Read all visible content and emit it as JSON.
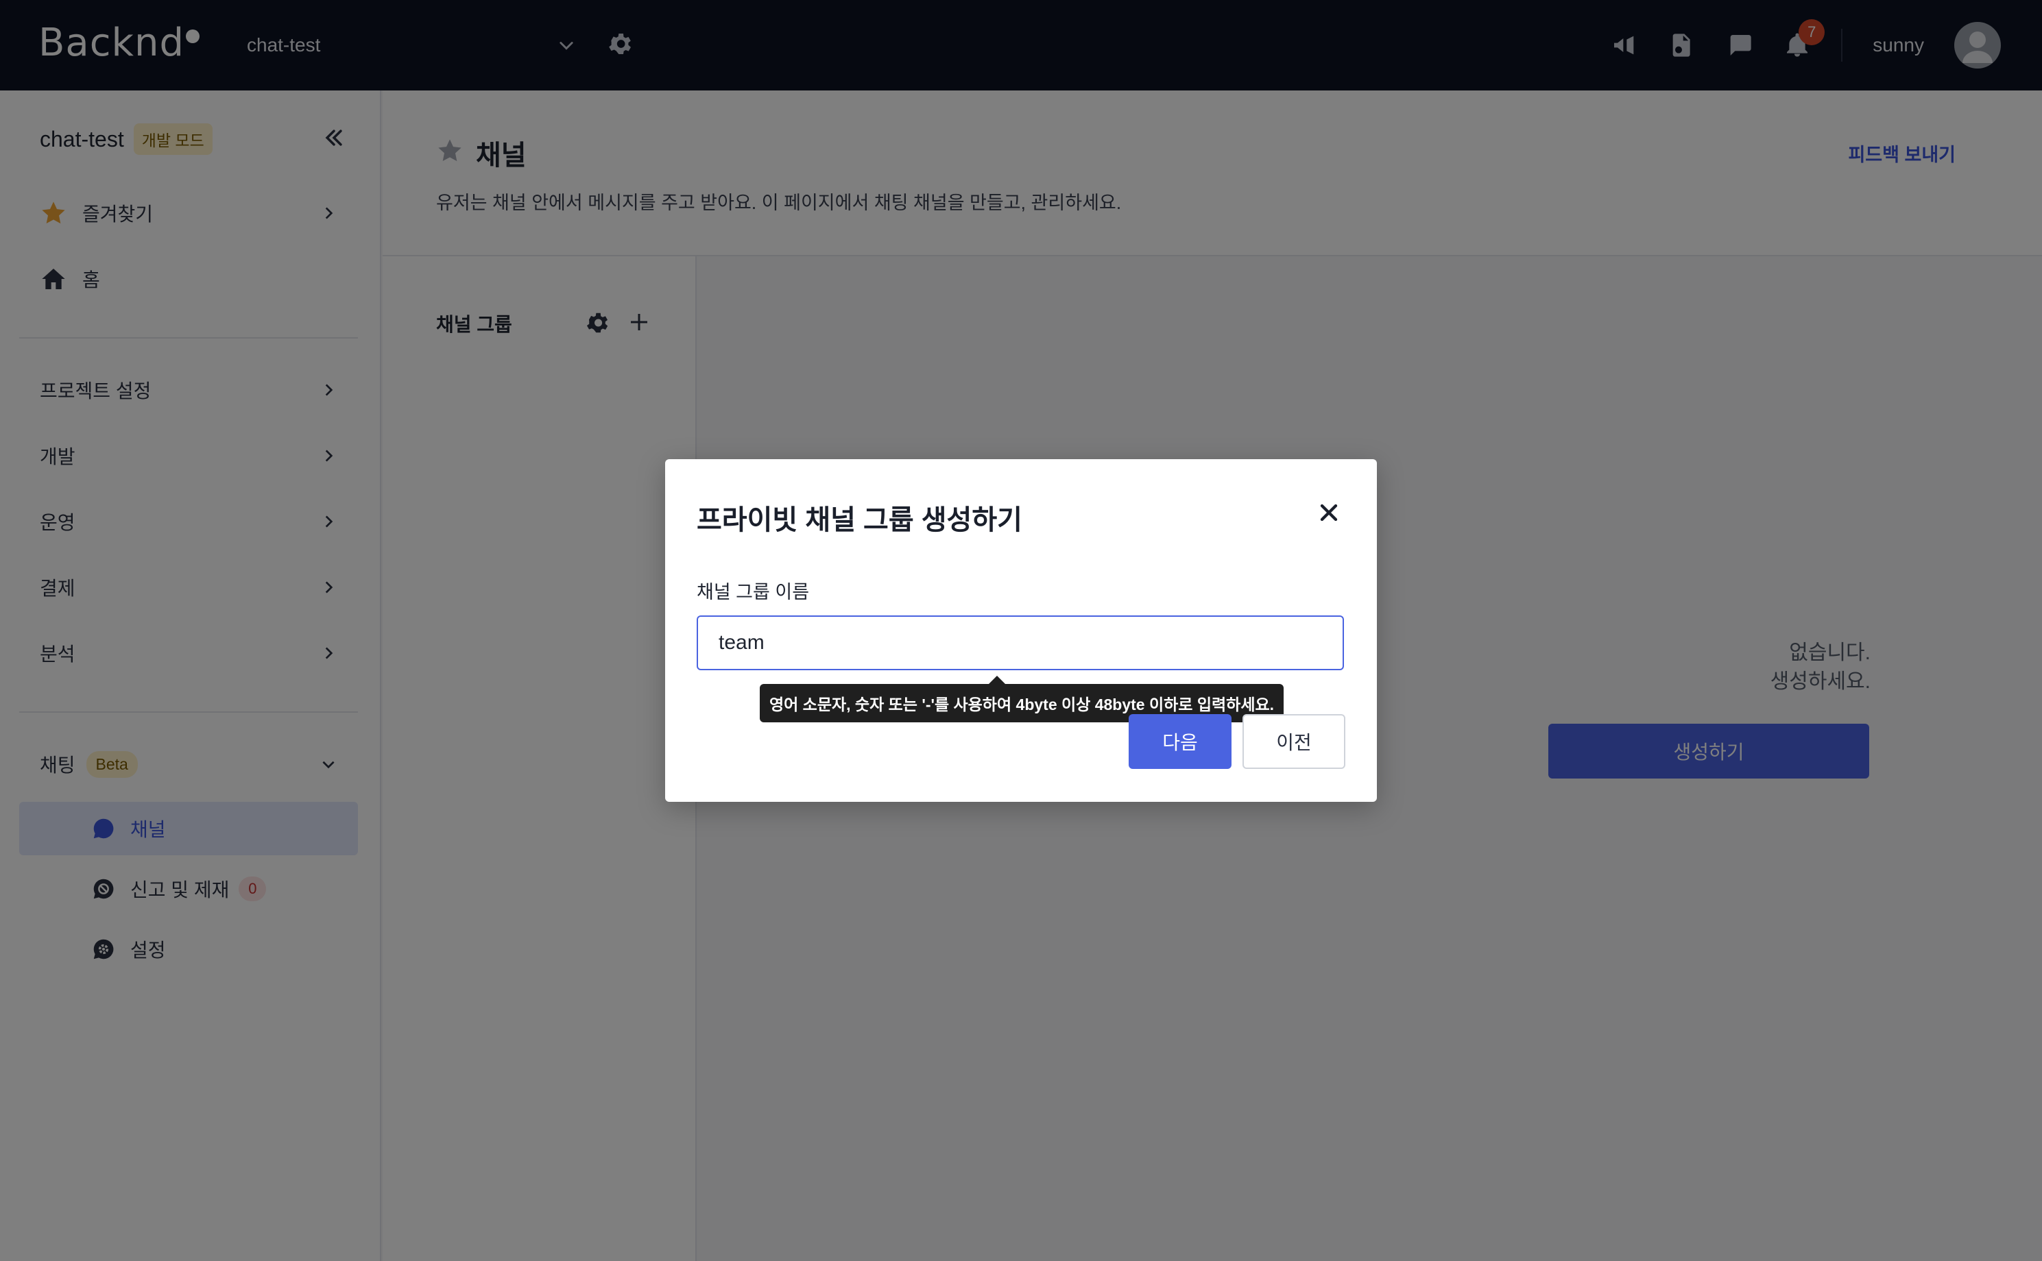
{
  "app": {
    "logo_text": "Backnd"
  },
  "header": {
    "project_name": "chat-test",
    "notification_count": "7",
    "username": "sunny",
    "icons": [
      "megaphone-icon",
      "document-icon",
      "chat-icon",
      "bell-icon",
      "gear-icon",
      "chevron-down-icon"
    ]
  },
  "sidebar": {
    "project_title": "chat-test",
    "mode_badge": "개발 모드",
    "items": [
      {
        "label": "즐겨찾기",
        "icon": "star-icon"
      },
      {
        "label": "홈",
        "icon": "home-icon"
      }
    ],
    "sections": [
      {
        "label": "프로젝트 설정"
      },
      {
        "label": "개발"
      },
      {
        "label": "운영"
      },
      {
        "label": "결제"
      },
      {
        "label": "분석"
      }
    ],
    "chat": {
      "label": "채팅",
      "badge": "Beta",
      "sub_items": [
        {
          "label": "채널",
          "icon": "chat-bubble-icon",
          "active": true
        },
        {
          "label": "신고 및 제재",
          "icon": "ban-icon",
          "count": "0"
        },
        {
          "label": "설정",
          "icon": "settings-icon"
        }
      ]
    }
  },
  "page": {
    "title": "채널",
    "description": "유저는 채널 안에서 메시지를 주고 받아요. 이 페이지에서 채팅 채널을 만들고, 관리하세요.",
    "feedback_link": "피드백 보내기",
    "channel_group_title": "채널 그룹",
    "empty_line1": "없습니다.",
    "empty_line2": "생성하세요.",
    "empty_button": "생성하기"
  },
  "modal": {
    "title": "프라이빗 채널 그룹 생성하기",
    "field_label": "채널 그룹 이름",
    "field_value": "team",
    "tooltip": "영어 소문자, 숫자 또는 '-'를 사용하여 4byte 이상 48byte 이하로 입력하세요.",
    "next_button": "다음",
    "prev_button": "이전"
  },
  "colors": {
    "topbar_bg": "#0d1323",
    "accent": "#4a63e0",
    "notification_badge": "#d9482b",
    "star": "#f0a534",
    "active_item_bg": "#e1e6fb"
  }
}
